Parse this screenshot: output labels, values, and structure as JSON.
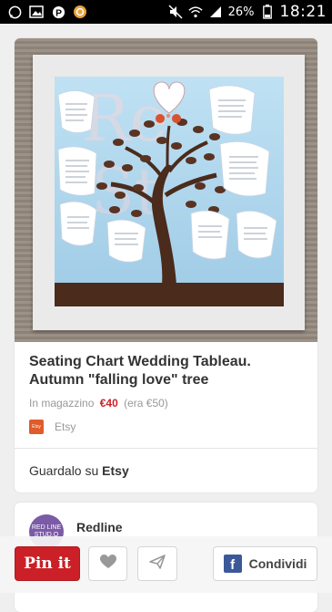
{
  "status_bar": {
    "battery": "26%",
    "time": "18:21",
    "icons": [
      "whatsapp-icon",
      "gallery-icon",
      "pinterest-icon",
      "app-icon",
      "mute-icon",
      "wifi-icon",
      "signal-icon",
      "battery-icon"
    ]
  },
  "pin": {
    "title": "Seating Chart Wedding Tableau. Autumn \"falling love\" tree",
    "stock_label": "In magazzino",
    "price": "€40",
    "price_original": "(era €50)",
    "source_name": "Etsy",
    "source_badge": "Etsy",
    "visit_prefix": "Guardalo su",
    "visit_site": "Etsy"
  },
  "pinner": {
    "name": "Redline",
    "avatar_text": "RED LINE STUD.O"
  },
  "actions": {
    "pin_it": "Pin it",
    "share": "Condividi"
  },
  "colors": {
    "pinterest_red": "#cb2027",
    "facebook_blue": "#3b5998",
    "sky": "#a9d3ec",
    "tree_brown": "#4a2b1c"
  }
}
